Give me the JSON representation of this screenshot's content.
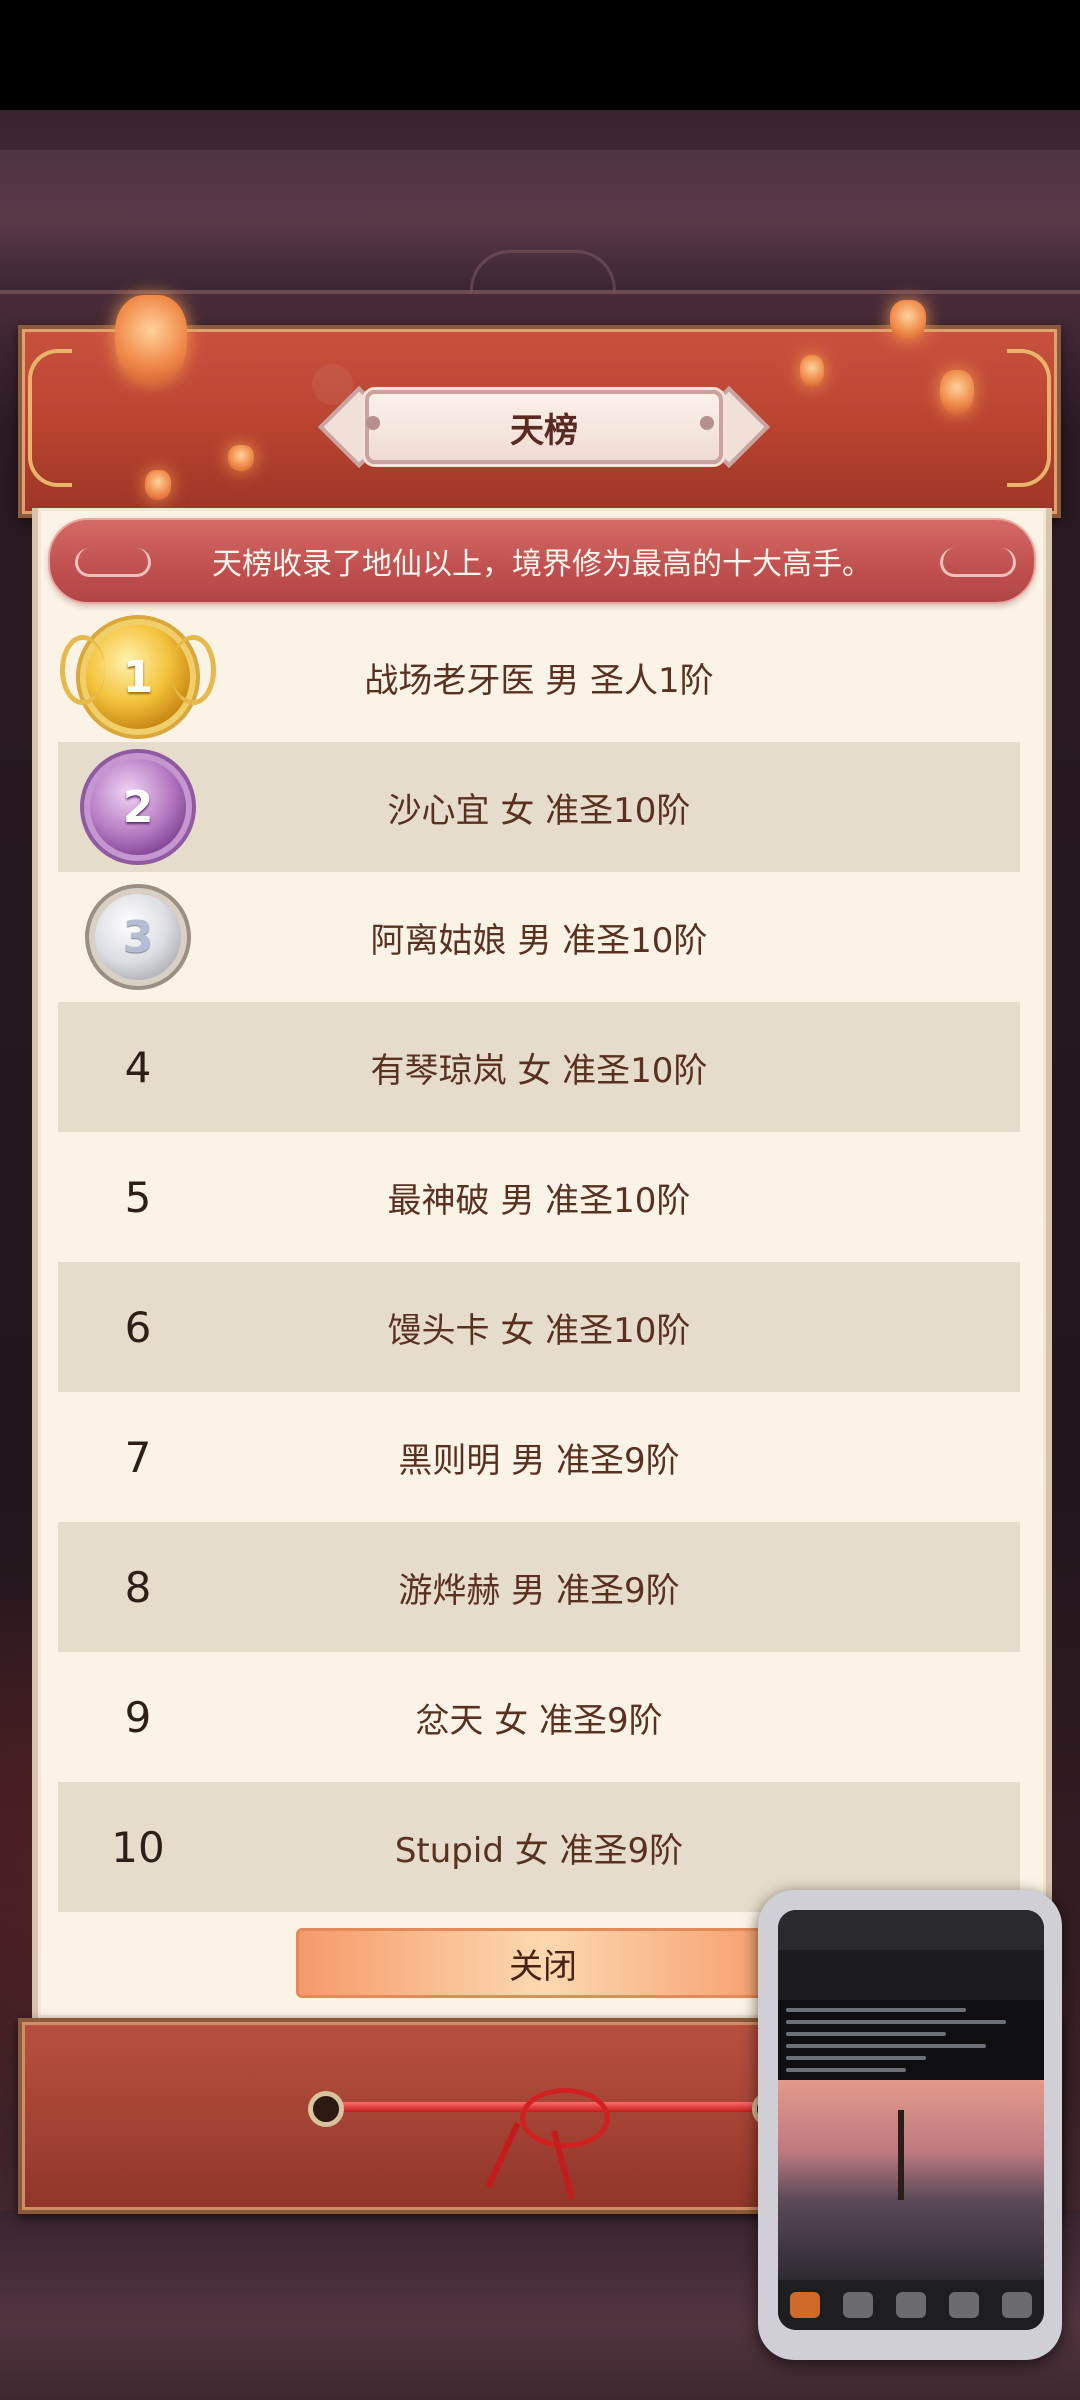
{
  "header": {
    "title": "天榜"
  },
  "subtitle": "天榜收录了地仙以上，境界修为最高的十大高手。",
  "rankings": [
    {
      "rank": "1",
      "entry": "战场老牙医 男 圣人1阶"
    },
    {
      "rank": "2",
      "entry": "沙心宜 女 准圣10阶"
    },
    {
      "rank": "3",
      "entry": "阿离姑娘 男 准圣10阶"
    },
    {
      "rank": "4",
      "entry": "有琴琼岚 女 准圣10阶"
    },
    {
      "rank": "5",
      "entry": "最神破 男 准圣10阶"
    },
    {
      "rank": "6",
      "entry": "馒头卡 女 准圣10阶"
    },
    {
      "rank": "7",
      "entry": "黑则明 男 准圣9阶"
    },
    {
      "rank": "8",
      "entry": "游烨赫 男 准圣9阶"
    },
    {
      "rank": "9",
      "entry": "忿天 女 准圣9阶"
    },
    {
      "rank": "10",
      "entry": "Stupid 女 准圣9阶"
    }
  ],
  "close_label": "关闭",
  "icons": {
    "rank1": "gold-medal-icon",
    "rank2": "purple-medal-icon",
    "rank3": "silver-medal-icon"
  },
  "colors": {
    "header_red": "#b8432f",
    "paper": "#fbf4e6",
    "row_shade": "#e6dccb",
    "text_brown": "#5a3020",
    "button_orange": "#f59a6a"
  }
}
